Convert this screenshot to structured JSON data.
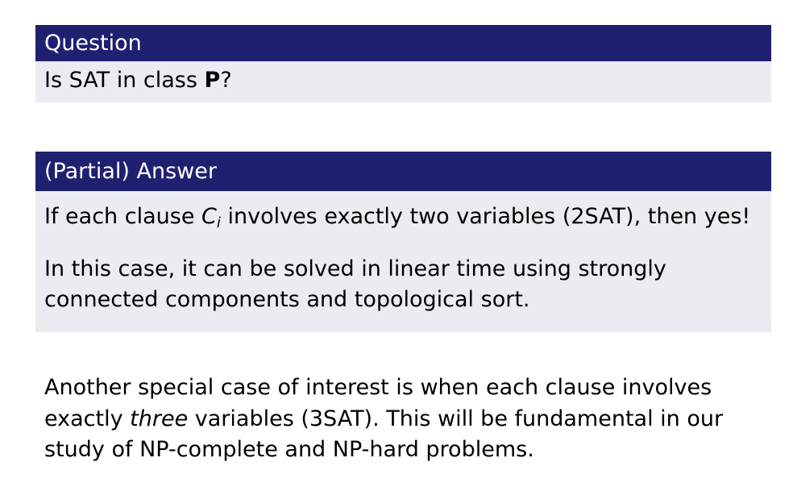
{
  "question_block": {
    "title": "Question",
    "body_prefix": "Is SAT in class ",
    "body_bold": "P",
    "body_suffix": "?"
  },
  "answer_block": {
    "title": "(Partial) Answer",
    "line1_prefix": "If each clause ",
    "line1_var": "C",
    "line1_sub": "i",
    "line1_suffix": " involves exactly two variables (2SAT), then yes!",
    "para2_line1": "In this case, it can be solved in linear time using strongly",
    "para2_line2": "connected components and topological sort."
  },
  "closing_paragraph": {
    "line1": "Another special case of interest is when each clause involves",
    "line2_prefix": "exactly ",
    "line2_emph": "three",
    "line2_suffix": " variables (3SAT). This will be fundamental in our",
    "line3": "study of NP-complete and NP-hard problems."
  }
}
